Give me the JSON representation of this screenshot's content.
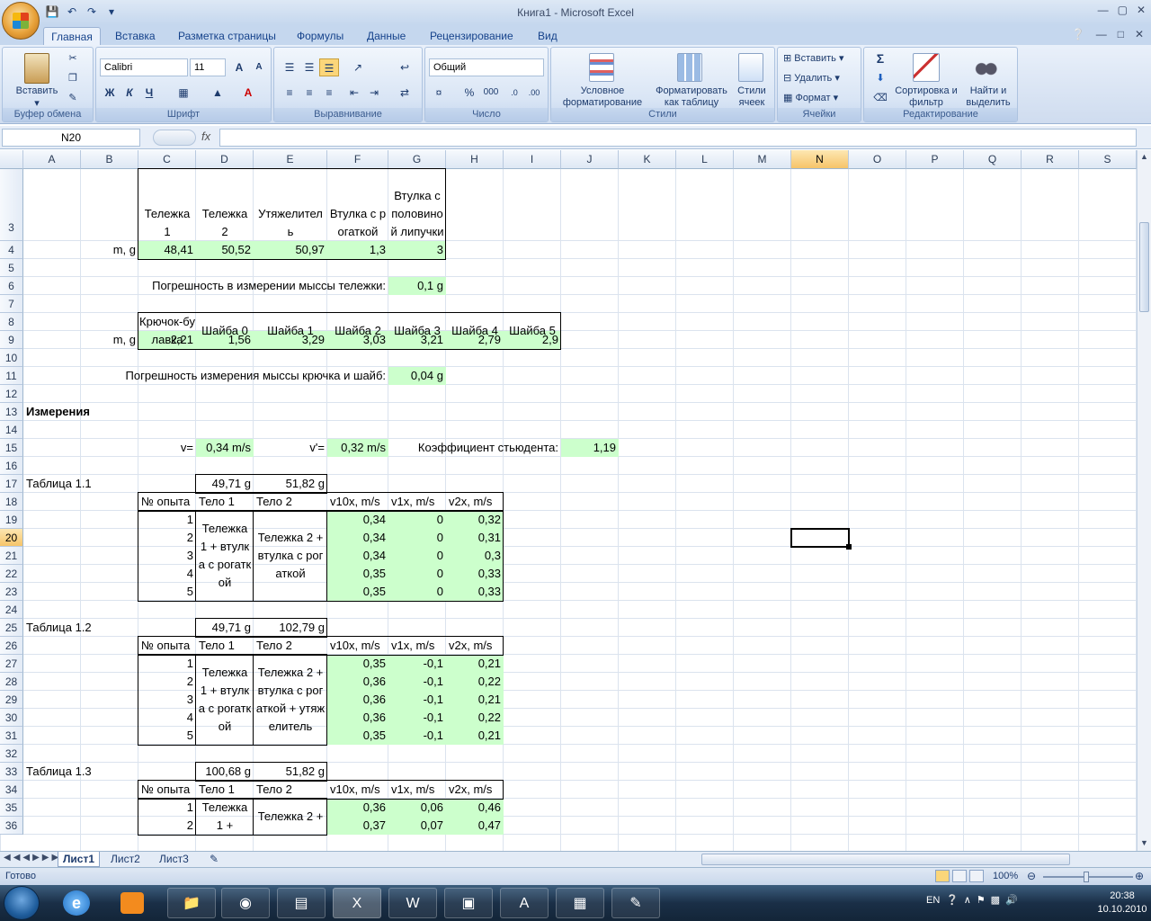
{
  "window": {
    "title": "Книга1 - Microsoft Excel"
  },
  "ribbon": {
    "tabs": [
      "Главная",
      "Вставка",
      "Разметка страницы",
      "Формулы",
      "Данные",
      "Рецензирование",
      "Вид"
    ],
    "groups": {
      "clipboard": {
        "label": "Буфер обмена",
        "paste": "Вставить"
      },
      "font": {
        "label": "Шрифт",
        "font_name": "Calibri",
        "font_size": "11",
        "bold": "Ж",
        "italic": "К",
        "underline": "Ч"
      },
      "alignment": {
        "label": "Выравнивание"
      },
      "number": {
        "label": "Число",
        "format": "Общий",
        "percent": "%",
        "thousands": "000"
      },
      "styles": {
        "label": "Стили",
        "cond_format": "Условное форматирование",
        "format_table": "Форматировать как таблицу",
        "cell_styles": "Стили ячеек"
      },
      "cells": {
        "label": "Ячейки",
        "insert": "Вставить",
        "delete": "Удалить",
        "format": "Формат"
      },
      "editing": {
        "label": "Редактирование",
        "sum": "Σ",
        "sort": "Сортировка и фильтр",
        "find": "Найти и выделить"
      }
    }
  },
  "formula_bar": {
    "name_box": "N20",
    "fx": "fx",
    "value": ""
  },
  "columns": [
    "A",
    "B",
    "C",
    "D",
    "E",
    "F",
    "G",
    "H",
    "I",
    "J",
    "K",
    "L",
    "M",
    "N",
    "O",
    "P",
    "Q",
    "R",
    "S"
  ],
  "selected_column": "N",
  "selected_row": "20",
  "rows": [
    "3",
    "4",
    "5",
    "6",
    "7",
    "8",
    "9",
    "10",
    "11",
    "12",
    "13",
    "14",
    "15",
    "16",
    "17",
    "18",
    "19",
    "20",
    "21",
    "22",
    "23",
    "24",
    "25",
    "26",
    "27",
    "28",
    "29",
    "30",
    "31",
    "32",
    "33",
    "34",
    "35",
    "36"
  ],
  "cells": {
    "r3": {
      "C": "Тележка 1",
      "D": "Тележка 2",
      "E": "Утяжелитель",
      "F": "Втулка с рогаткой",
      "G": "Втулка с половиной липучки"
    },
    "r4": {
      "B": "m, g",
      "C": "48,41",
      "D": "50,52",
      "E": "50,97",
      "F": "1,3",
      "G": "3"
    },
    "r6": {
      "label": "Погрешность в измерении мыссы тележки:",
      "G": "0,1 g"
    },
    "r8": {
      "C": "Крючок-булавка",
      "D": "Шайба 0",
      "E": "Шайба 1",
      "F": "Шайба 2",
      "G": "Шайба 3",
      "H": "Шайба 4",
      "I": "Шайба 5"
    },
    "r9": {
      "B": "m, g",
      "C": "2,21",
      "D": "1,56",
      "E": "3,29",
      "F": "3,03",
      "G": "3,21",
      "H": "2,79",
      "I": "2,9"
    },
    "r11": {
      "label": "Погрешность измерения мыссы крючка и шайб:",
      "G": "0,04 g"
    },
    "r13": {
      "A": "Измерения"
    },
    "r15": {
      "C": "v=",
      "D": "0,34 m/s",
      "E": "v'=",
      "F": "0,32 m/s",
      "label": "Коэффициент стьюдента:",
      "J": "1,19"
    }
  },
  "tables": [
    {
      "title": "Таблица 1.1",
      "m1": "49,71 g",
      "m2": "51,82 g",
      "headers": [
        "№ опыта",
        "Тело 1",
        "Тело 2",
        "v10x, m/s",
        "v1x, m/s",
        "v2x, m/s"
      ],
      "body1": "Тележка 1 + втулка с рогаткой",
      "body2": "Тележка 2 + втулка с рогаткой",
      "rows": [
        [
          "1",
          "0,34",
          "0",
          "0,32"
        ],
        [
          "2",
          "0,34",
          "0",
          "0,31"
        ],
        [
          "3",
          "0,34",
          "0",
          "0,3"
        ],
        [
          "4",
          "0,35",
          "0",
          "0,33"
        ],
        [
          "5",
          "0,35",
          "0",
          "0,33"
        ]
      ]
    },
    {
      "title": "Таблица 1.2",
      "m1": "49,71 g",
      "m2": "102,79 g",
      "headers": [
        "№ опыта",
        "Тело 1",
        "Тело 2",
        "v10x, m/s",
        "v1x, m/s",
        "v2x, m/s"
      ],
      "body1": "Тележка 1 + втулка с рогаткой",
      "body2": "Тележка 2 + втулка с рогаткой + утяжелитель",
      "rows": [
        [
          "1",
          "0,35",
          "-0,1",
          "0,21"
        ],
        [
          "2",
          "0,36",
          "-0,1",
          "0,22"
        ],
        [
          "3",
          "0,36",
          "-0,1",
          "0,21"
        ],
        [
          "4",
          "0,36",
          "-0,1",
          "0,22"
        ],
        [
          "5",
          "0,35",
          "-0,1",
          "0,21"
        ]
      ]
    },
    {
      "title": "Таблица 1.3",
      "m1": "100,68 g",
      "m2": "51,82 g",
      "headers": [
        "№ опыта",
        "Тело 1",
        "Тело 2",
        "v10x, m/s",
        "v1x, m/s",
        "v2x, m/s"
      ],
      "body1": "Тележка 1 +",
      "body2": "Тележка 2 +",
      "rows": [
        [
          "1",
          "0,36",
          "0,06",
          "0,46"
        ],
        [
          "2",
          "0,37",
          "0,07",
          "0,47"
        ]
      ]
    }
  ],
  "sheet_tabs": [
    "Лист1",
    "Лист2",
    "Лист3"
  ],
  "status": {
    "ready": "Готово",
    "zoom": "100%"
  },
  "tray": {
    "lang": "EN",
    "time": "20:38",
    "date": "10.10.2010"
  }
}
